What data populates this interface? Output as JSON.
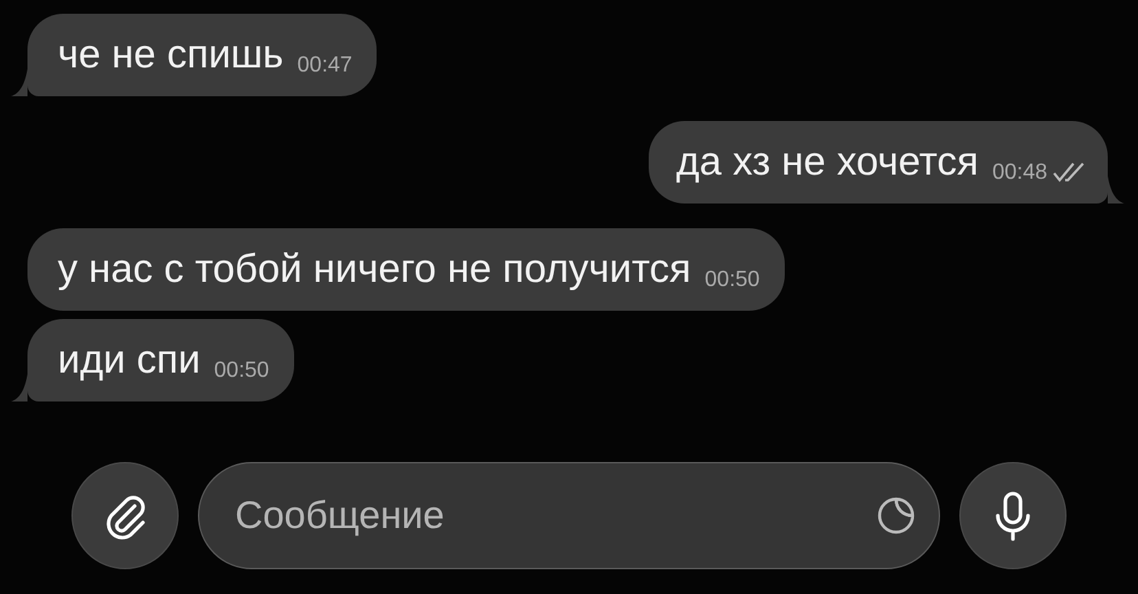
{
  "messages": [
    {
      "kind": "incoming",
      "text": "че не спишь",
      "time": "00:47",
      "tail": true
    },
    {
      "kind": "outgoing",
      "text": "да хз не хочется",
      "time": "00:48",
      "tail": true,
      "read": true
    },
    {
      "kind": "incoming",
      "text": "у нас с тобой ничего не получится",
      "time": "00:50",
      "tail": false
    },
    {
      "kind": "incoming",
      "text": "иди спи",
      "time": "00:50",
      "tail": true
    }
  ],
  "composer": {
    "placeholder": "Сообщение"
  }
}
